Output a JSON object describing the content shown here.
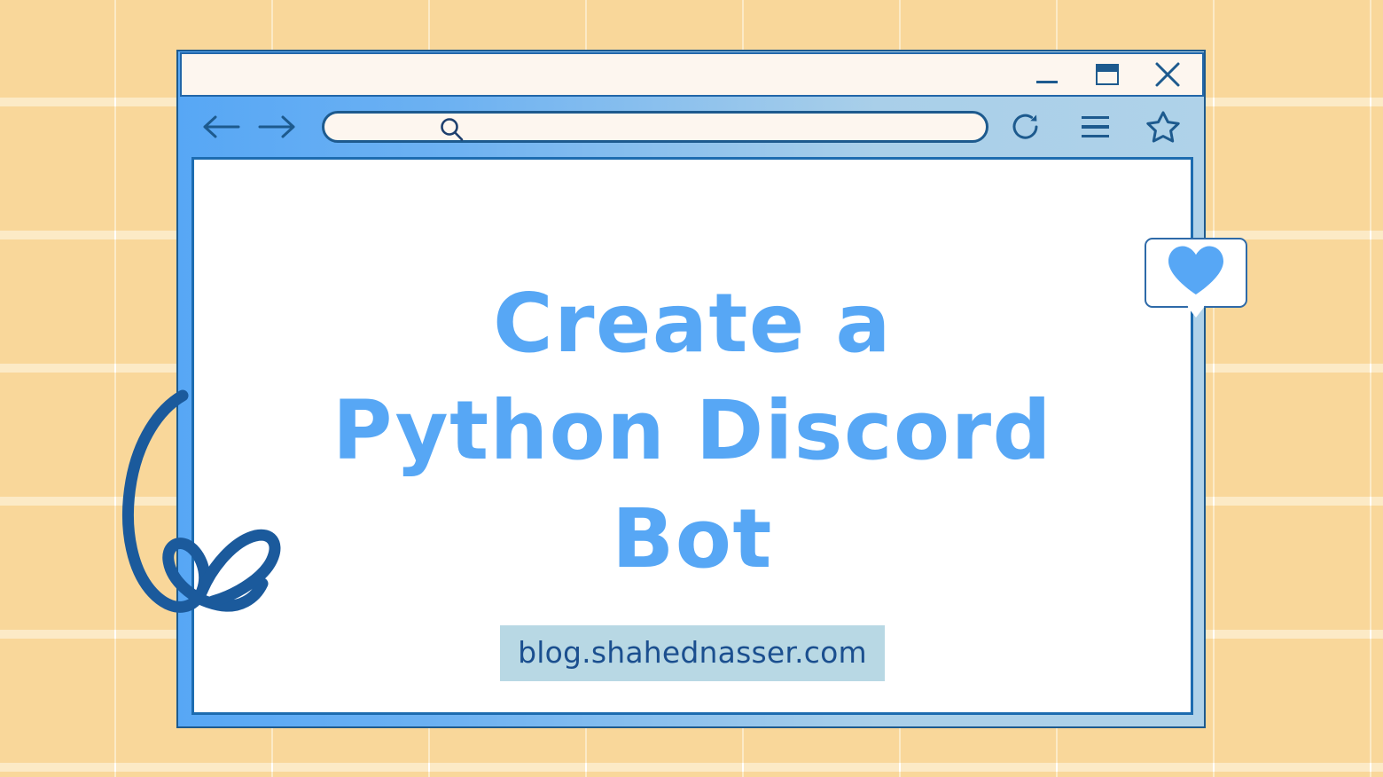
{
  "background": {
    "tile_color": "#fceac6",
    "gap_color": "#ffffff"
  },
  "browser": {
    "frame_gradient_from": "#57a7f5",
    "frame_gradient_to": "#afd2e9",
    "outline_color": "#1d5a8e",
    "title_bar": {
      "background": "#fdf6ef",
      "controls": [
        {
          "name": "minimize",
          "glyph": "minimize-icon"
        },
        {
          "name": "maximize",
          "glyph": "maximize-icon"
        },
        {
          "name": "close",
          "glyph": "close-icon"
        }
      ]
    },
    "toolbar": {
      "back_icon": "arrow-left-icon",
      "forward_icon": "arrow-right-icon",
      "reload_icon": "reload-icon",
      "menu_icon": "hamburger-menu-icon",
      "bookmark_icon": "star-icon",
      "address_bar": {
        "value": "",
        "placeholder": "",
        "search_icon": "search-icon",
        "background": "#fdf6ef"
      }
    }
  },
  "page": {
    "title": "Create a\nPython Discord\nBot",
    "title_color": "#57a7f5",
    "url_badge": {
      "text": "blog.shahednasser.com",
      "background": "#b8d8e4",
      "text_color": "#1b4f8f"
    },
    "background": "#ffffff"
  },
  "decorations": {
    "heart_bubble": {
      "icon": "heart-icon",
      "heart_color": "#57a7f5",
      "bubble_background": "#ffffff",
      "bubble_border": "#2e6aa8"
    },
    "squiggle": {
      "name": "hand-drawn-flourish",
      "color": "#1b5a9c"
    }
  }
}
